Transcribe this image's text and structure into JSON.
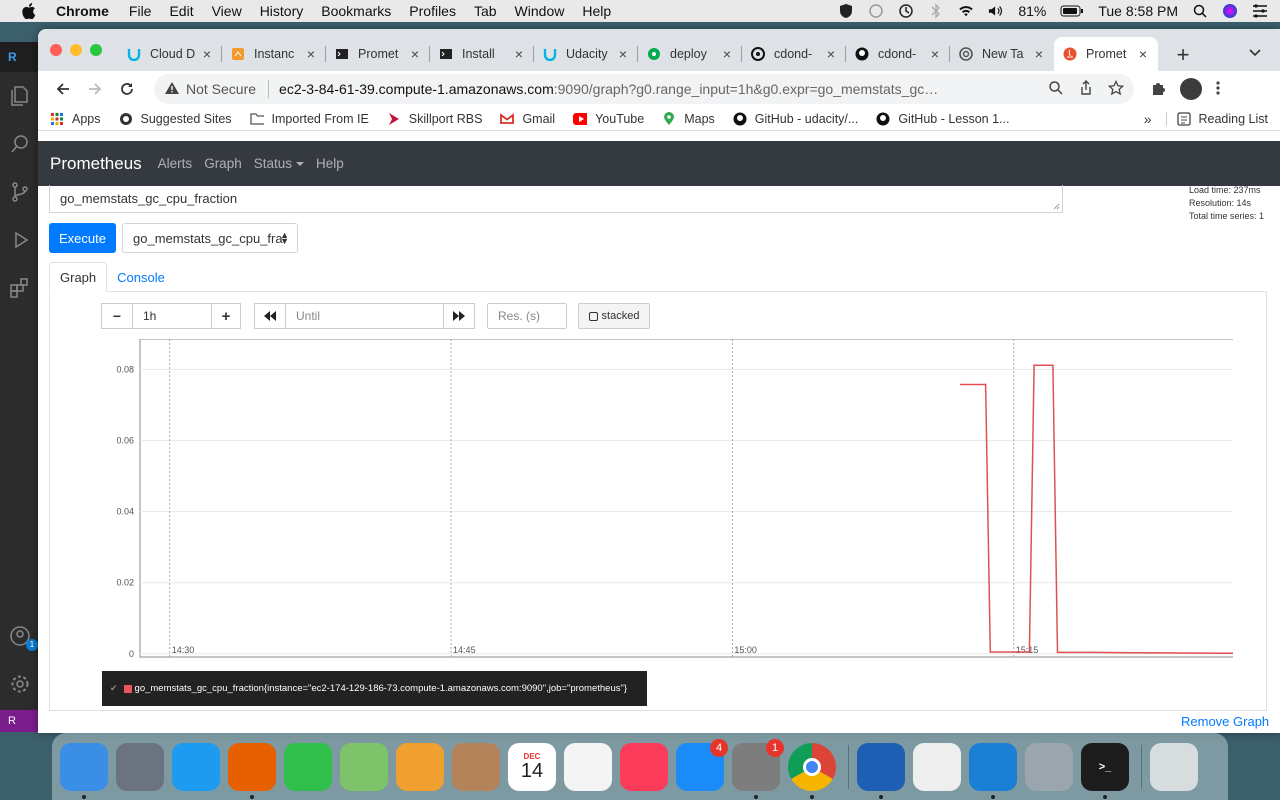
{
  "menubar": {
    "app": "Chrome",
    "items": [
      "File",
      "Edit",
      "View",
      "History",
      "Bookmarks",
      "Profiles",
      "Tab",
      "Window",
      "Help"
    ],
    "battery": "81%",
    "clock": "Tue 8:58 PM"
  },
  "vscode": {
    "top_label": "R",
    "badge": "1",
    "bottom_label": "R"
  },
  "browser": {
    "tabs": [
      {
        "label": "Cloud D",
        "icon": "udacity-icon"
      },
      {
        "label": "Instanc",
        "icon": "aws-icon"
      },
      {
        "label": "Promet",
        "icon": "terminal-icon"
      },
      {
        "label": "Install",
        "icon": "terminal-icon"
      },
      {
        "label": "Udacity",
        "icon": "udacity-icon"
      },
      {
        "label": "deploy",
        "icon": "circleci-icon"
      },
      {
        "label": "cdond-",
        "icon": "circleci-dark-icon"
      },
      {
        "label": "cdond-",
        "icon": "github-icon"
      },
      {
        "label": "New Ta",
        "icon": "chrome-icon"
      },
      {
        "label": "Promet",
        "icon": "prometheus-icon"
      }
    ],
    "security": "Not Secure",
    "url_host": "ec2-3-84-61-39.compute-1.amazonaws.com",
    "url_rest": ":9090/graph?g0.range_input=1h&g0.expr=go_memstats_gc_cpu_fraction...",
    "bookmarks": [
      "Apps",
      "Suggested Sites",
      "Imported From IE",
      "Skillport RBS",
      "Gmail",
      "YouTube",
      "Maps",
      "GitHub - udacity/...",
      "GitHub - Lesson 1..."
    ],
    "bookmarks_more": "»",
    "reading_list": "Reading List"
  },
  "prometheus": {
    "brand": "Prometheus",
    "nav": [
      "Alerts",
      "Graph",
      "Status",
      "Help"
    ],
    "expression": "go_memstats_gc_cpu_fraction",
    "stats": [
      "Load time: 237ms",
      "Resolution: 14s",
      "Total time series: 1"
    ],
    "execute_label": "Execute",
    "metric_select": "go_memstats_gc_cpu_fra",
    "tabs": [
      "Graph",
      "Console"
    ],
    "range": "1h",
    "until_placeholder": "Until",
    "res_placeholder": "Res. (s)",
    "stacked_label": "stacked",
    "minus": "−",
    "plus": "+",
    "legend": "go_memstats_gc_cpu_fraction{instance=\"ec2-174-129-186-73.compute-1.amazonaws.com:9090\",job=\"prometheus\"}",
    "remove_graph": "Remove Graph"
  },
  "chart_data": {
    "type": "line",
    "xlabel": "",
    "ylabel": "",
    "x_ticks": [
      "14:30",
      "14:45",
      "15:00",
      "15:15"
    ],
    "y_ticks": [
      "0",
      "0.02",
      "0.04",
      "0.06",
      "0.08"
    ],
    "xlim": [
      "14:28:25",
      "15:28:30"
    ],
    "ylim": [
      -0.0009,
      0.0886
    ],
    "grid": true,
    "series": [
      {
        "name": "go_memstats_gc_cpu_fraction{instance=\"ec2-174-129-186-73.compute-1.amazonaws.com:9090\",job=\"prometheus\"}",
        "color": "#e05050",
        "points": [
          [
            "15:12:10",
            0.0758
          ],
          [
            "15:13:30",
            0.0758
          ],
          [
            "15:13:45",
            0.0005
          ],
          [
            "15:15:50",
            0.0005
          ],
          [
            "15:16:05",
            0.0812
          ],
          [
            "15:17:05",
            0.0812
          ],
          [
            "15:17:20",
            0.0004
          ],
          [
            "15:19:15",
            0.0004
          ],
          [
            "15:21:10",
            0.0003
          ],
          [
            "15:25:00",
            0.0002
          ],
          [
            "15:28:30",
            0.0001
          ]
        ]
      }
    ]
  },
  "dock": {
    "apps": [
      {
        "name": "finder-icon",
        "label": "",
        "color": "#3a8ee6"
      },
      {
        "name": "launchpad-icon",
        "label": "",
        "color": "#6b7280"
      },
      {
        "name": "safari-icon",
        "label": "",
        "color": "#1d9bf0"
      },
      {
        "name": "firefox-icon",
        "label": "",
        "color": "#e66000"
      },
      {
        "name": "facetime-icon",
        "label": "",
        "color": "#2fbf4a"
      },
      {
        "name": "maps-icon",
        "label": "",
        "color": "#7cc36a"
      },
      {
        "name": "photos-icon",
        "label": "",
        "color": "#f0a030"
      },
      {
        "name": "contacts-icon",
        "label": "",
        "color": "#b5835a"
      },
      {
        "name": "calendar-icon",
        "label": "14",
        "color": "#ffffff"
      },
      {
        "name": "reminders-icon",
        "label": "",
        "color": "#f4f4f4"
      },
      {
        "name": "music-icon",
        "label": "",
        "color": "#fa3c5a"
      },
      {
        "name": "app-store-icon",
        "label": "",
        "color": "#1b8cf7",
        "badge": "4"
      },
      {
        "name": "system-preferences-icon",
        "label": "",
        "color": "#7d7d7d",
        "badge": "1"
      },
      {
        "name": "chrome-icon",
        "label": "",
        "color": "#ffffff"
      },
      {
        "name": "multipass-icon",
        "label": "",
        "color": "#1f5fb3"
      },
      {
        "name": "textedit-icon",
        "label": "",
        "color": "#eeeeee"
      },
      {
        "name": "vscode-icon",
        "label": "",
        "color": "#1c7fd6"
      },
      {
        "name": "keychain-icon",
        "label": "",
        "color": "#9aa5ad"
      },
      {
        "name": "terminal-icon",
        "label": ">_",
        "color": "#1c1c1c"
      },
      {
        "name": "trash-icon",
        "label": "",
        "color": "#d7dcdf"
      }
    ],
    "calendar_month": "DEC"
  }
}
